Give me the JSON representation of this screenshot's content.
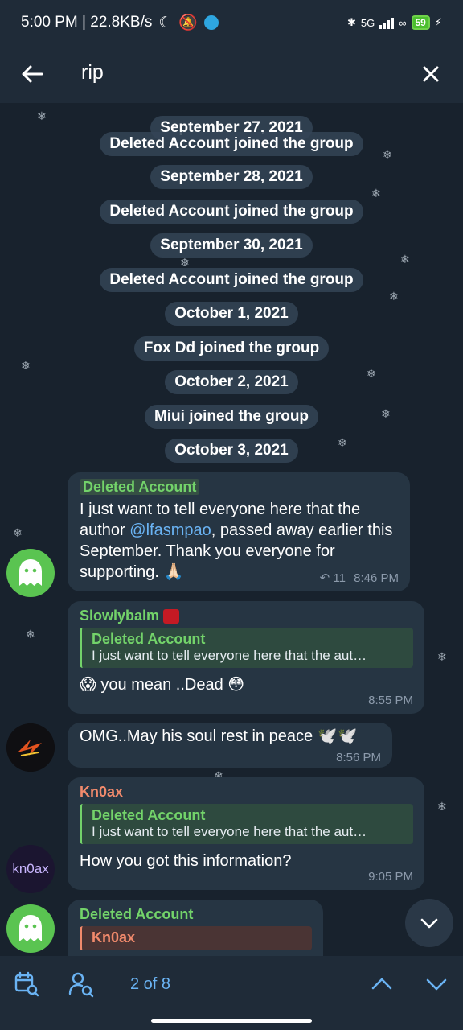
{
  "status": {
    "time_speed": "5:00 PM | 22.8KB/s",
    "net": "5G",
    "battery": "59"
  },
  "toolbar": {
    "search_query": "rip"
  },
  "service_messages": [
    "September 27, 2021",
    "Deleted Account joined the group",
    "September 28, 2021",
    "Deleted Account joined the group",
    "September 30, 2021",
    "Deleted Account joined the group",
    "October 1, 2021",
    "Fox Dd joined the group",
    "October 2, 2021",
    "Miui joined the group",
    "October 3, 2021"
  ],
  "messages": [
    {
      "sender": "Deleted Account",
      "text_before": "I just want to tell everyone here that the author ",
      "mention": "@lfasmpao",
      "text_after": ", passed away earlier this September. Thank you everyone for supporting. 🙏🏻",
      "forwards": "11",
      "time": "8:46 PM"
    },
    {
      "sender": "Slowlybalm",
      "reply_name": "Deleted Account",
      "reply_text": "I just want to tell everyone here that the aut…",
      "text": "😱 you mean ..Dead 😳",
      "time": "8:55 PM"
    },
    {
      "text": "OMG..May his soul rest in peace 🕊️🕊️",
      "time": "8:56 PM"
    },
    {
      "sender": "Kn0ax",
      "reply_name": "Deleted Account",
      "reply_text": "I just want to tell everyone here that the aut…",
      "text": "How you got this information?",
      "time": "9:05 PM",
      "avatar_text": "kn0ax"
    },
    {
      "sender": "Deleted Account",
      "reply_name": "Kn0ax"
    }
  ],
  "search_nav": {
    "counter": "2 of 8"
  },
  "colors": {
    "accent": "#6ab3f3",
    "bubble": "#263543",
    "green_name": "#73d36a",
    "orange_name": "#f18a6c"
  }
}
